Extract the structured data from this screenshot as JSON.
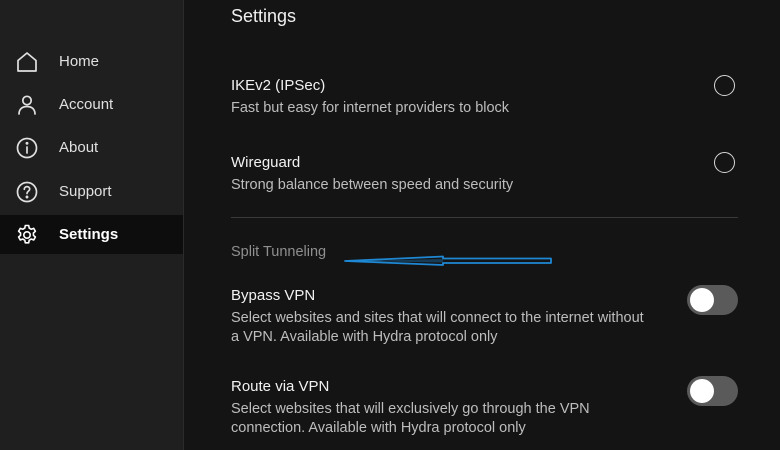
{
  "sidebar": {
    "items": [
      {
        "label": "Home",
        "icon": "home-icon"
      },
      {
        "label": "Account",
        "icon": "user-icon"
      },
      {
        "label": "About",
        "icon": "info-icon"
      },
      {
        "label": "Support",
        "icon": "help-icon"
      },
      {
        "label": "Settings",
        "icon": "gear-icon",
        "active": true
      }
    ]
  },
  "main": {
    "title": "Settings",
    "protocols": [
      {
        "title": "IKEv2 (IPSec)",
        "description": "Fast but easy for internet providers to block",
        "selected": false
      },
      {
        "title": "Wireguard",
        "description": "Strong balance between speed and security",
        "selected": false
      }
    ],
    "split_tunneling": {
      "section_label": "Split Tunneling",
      "options": [
        {
          "title": "Bypass VPN",
          "description": "Select websites and sites that will connect to the internet without a VPN. Available with Hydra protocol only",
          "enabled": false
        },
        {
          "title": "Route via VPN",
          "description": "Select websites that will exclusively go through the VPN connection. Available with Hydra protocol only",
          "enabled": false
        }
      ]
    }
  },
  "colors": {
    "sidebar_bg": "#1f1f1f",
    "main_bg": "#141414",
    "active_item_bg": "#0d0d0d",
    "toggle_off": "#5a5a5a",
    "annotation_arrow": "#1e88d4"
  }
}
